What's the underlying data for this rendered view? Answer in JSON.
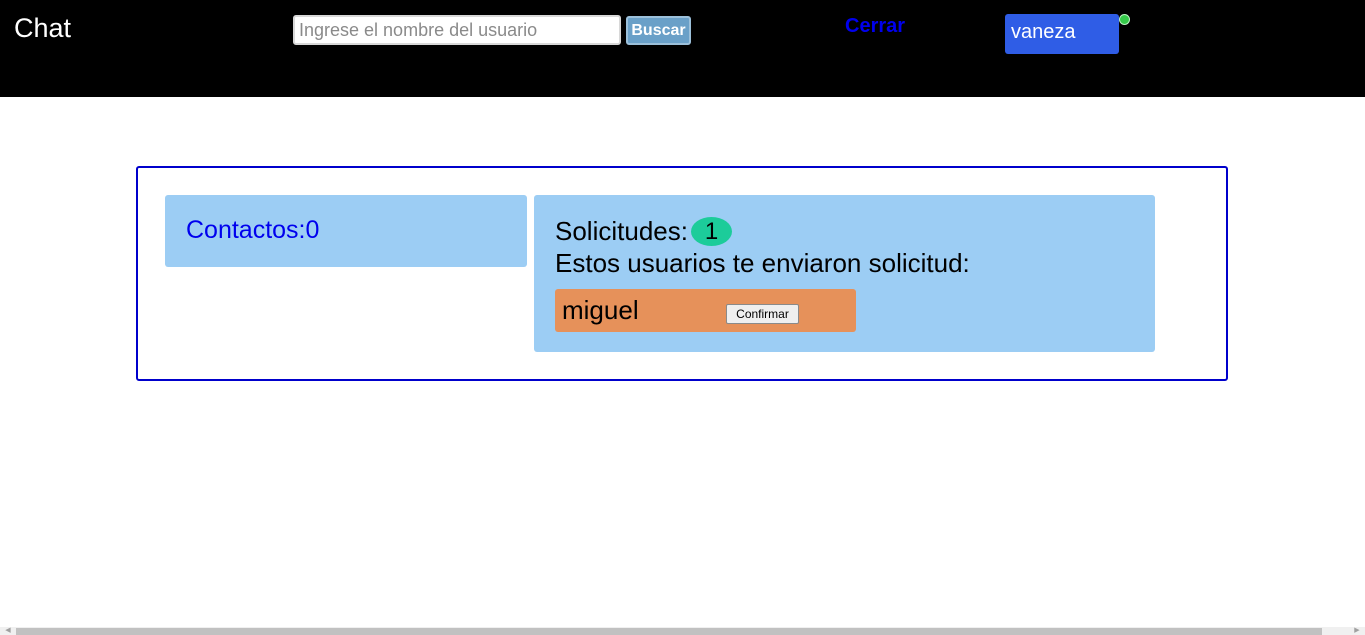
{
  "header": {
    "app_title": "Chat",
    "search": {
      "placeholder": "Ingrese el nombre del usuario",
      "value": ""
    },
    "search_button_label": "Buscar",
    "logout_label": "Cerrar",
    "current_user": "vaneza",
    "status": "online"
  },
  "contacts": {
    "label": "Contactos:0"
  },
  "requests": {
    "title": "Solicitudes:",
    "count": "1",
    "subtitle": "Estos usuarios te enviaron solicitud:",
    "items": [
      {
        "name": "miguel",
        "confirm_label": "Confirmar"
      }
    ]
  },
  "colors": {
    "header_bg": "#000000",
    "panel_bg": "#9ccdf4",
    "frame_border": "#0000cc",
    "request_item_bg": "#e6915a",
    "count_badge_bg": "#1ccc9a",
    "user_badge_bg": "#2f5de6",
    "online_indicator": "#35c94a",
    "link_color": "#0000ee"
  }
}
